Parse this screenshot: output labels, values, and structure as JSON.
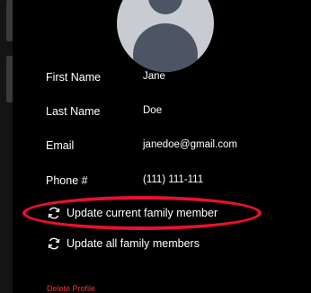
{
  "profile": {
    "avatar_icon": "user-avatar-placeholder",
    "fields": {
      "first_name_label": "First Name",
      "first_name_value": "Jane",
      "last_name_label": "Last Name",
      "last_name_value": "Doe",
      "email_label": "Email",
      "email_value": "janedoe@gmail.com",
      "phone_label": "Phone #",
      "phone_value": "(111) 111-111"
    }
  },
  "actions": {
    "update_current_icon": "refresh-icon",
    "update_current_label": "Update current family member",
    "update_all_icon": "refresh-icon",
    "update_all_label": "Update all family members",
    "delete_label": "Delete Profile"
  },
  "colors": {
    "background": "#000000",
    "text": "#ffffff",
    "avatar_bg": "#c8ccd2",
    "avatar_fg": "#4b5563",
    "highlight": "#e8112d",
    "delete": "#e53935"
  }
}
